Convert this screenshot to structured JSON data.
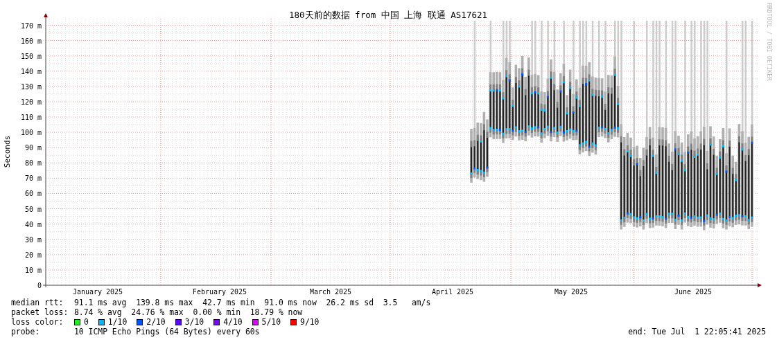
{
  "chart": {
    "title": "180天前的数据 from 中国 上海 联通 AS17621",
    "credit": "RRDTOOL / TOBI OETIKER",
    "ylabel": "Seconds",
    "yticks": [
      "170 m",
      "160 m",
      "150 m",
      "140 m",
      "130 m",
      "120 m",
      "110 m",
      "100 m",
      "90 m",
      "80 m",
      "70 m",
      "60 m",
      "50 m",
      "40 m",
      "30 m",
      "20 m",
      "10 m",
      "0"
    ],
    "months": [
      "January 2025",
      "February 2025",
      "March 2025",
      "April 2025",
      "May 2025",
      "June 2025"
    ]
  },
  "stats": [
    {
      "label": "median rtt:",
      "text": "91.1 ms avg  139.8 ms max  42.7 ms min  91.0 ms now  26.2 ms sd  3.5   am/s"
    },
    {
      "label": "packet loss:",
      "text": "8.74 % avg  24.76 % max  0.00 % min  18.79 % now"
    }
  ],
  "loss_color": {
    "label": "loss color:",
    "items": [
      {
        "label": "0",
        "color": "#22ee22"
      },
      {
        "label": "1/10",
        "color": "#00b8ff"
      },
      {
        "label": "2/10",
        "color": "#0059ff"
      },
      {
        "label": "3/10",
        "color": "#5e00ff"
      },
      {
        "label": "4/10",
        "color": "#7e00ff"
      },
      {
        "label": "5/10",
        "color": "#dd00ff"
      },
      {
        "label": "9/10",
        "color": "#ff0000"
      }
    ]
  },
  "probe": {
    "label": "probe:",
    "text": "10 ICMP Echo Pings (64 Bytes) every 60s"
  },
  "end": "end: Tue Jul  1 22:05:41 2025"
}
